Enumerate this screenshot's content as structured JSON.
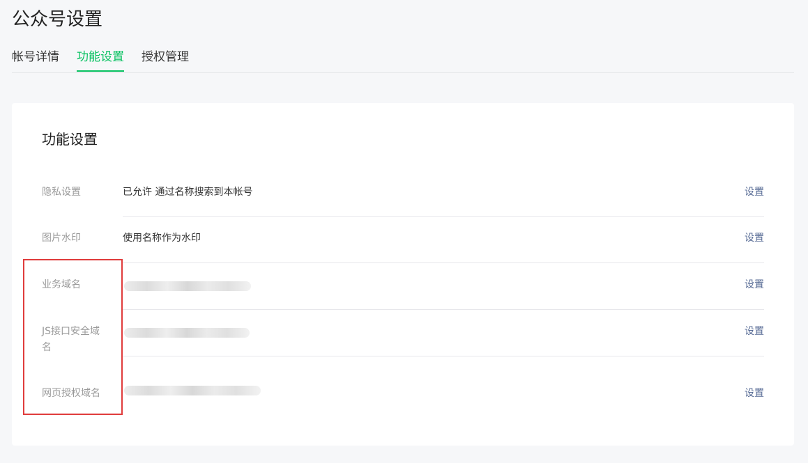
{
  "page": {
    "title": "公众号设置"
  },
  "tabs": [
    {
      "label": "帐号详情",
      "active": false
    },
    {
      "label": "功能设置",
      "active": true
    },
    {
      "label": "授权管理",
      "active": false
    }
  ],
  "section": {
    "title": "功能设置",
    "rows": [
      {
        "label": "隐私设置",
        "value": "已允许 通过名称搜索到本帐号",
        "action": "设置"
      },
      {
        "label": "图片水印",
        "value": "使用名称作为水印",
        "action": "设置"
      },
      {
        "label": "业务域名",
        "value": "",
        "action": "设置"
      },
      {
        "label": "JS接口安全域名",
        "value": "",
        "action": "设置"
      },
      {
        "label": "网页授权域名",
        "value": "",
        "action": "设置"
      }
    ]
  },
  "colors": {
    "accent": "#07c160",
    "link": "#576b95",
    "highlight_border": "#e03c3c"
  }
}
